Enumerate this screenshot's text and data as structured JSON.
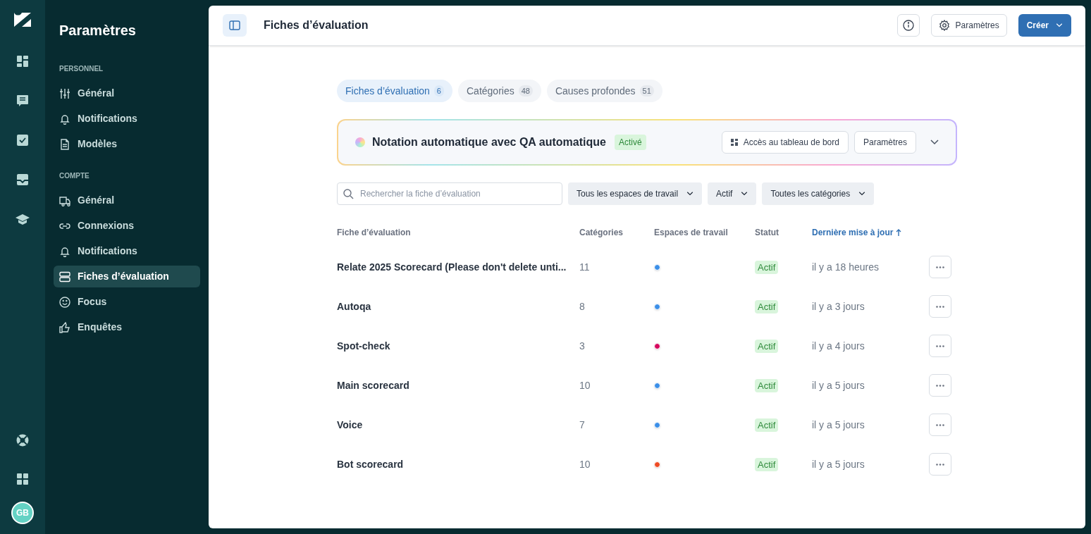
{
  "rail": {
    "avatar": "GB"
  },
  "nav": {
    "title": "Paramètres",
    "sections": [
      {
        "label": "PERSONNEL",
        "items": [
          {
            "label": "Général",
            "selected": false
          },
          {
            "label": "Notifications",
            "selected": false
          },
          {
            "label": "Modèles",
            "selected": false
          }
        ]
      },
      {
        "label": "COMPTE",
        "items": [
          {
            "label": "Général",
            "selected": false
          },
          {
            "label": "Connexions",
            "selected": false
          },
          {
            "label": "Notifications",
            "selected": false
          },
          {
            "label": "Fiches d’évaluation",
            "selected": true
          },
          {
            "label": "Focus",
            "selected": false
          },
          {
            "label": "Enquêtes",
            "selected": false
          }
        ]
      }
    ]
  },
  "header": {
    "title": "Fiches d’évaluation",
    "settings_button": "Paramètres",
    "create_button": "Créer"
  },
  "tabs": [
    {
      "label": "Fiches d’évaluation",
      "count": "6",
      "selected": true
    },
    {
      "label": "Catégories",
      "count": "48",
      "selected": false
    },
    {
      "label": "Causes profondes",
      "count": "51",
      "selected": false
    }
  ],
  "banner": {
    "title": "Notation automatique avec QA automatique",
    "badge": "Activé",
    "dashboard_button": "Accès au tableau de bord",
    "settings_button": "Paramètres"
  },
  "filters": {
    "search": {
      "placeholder": "Rechercher la fiche d’évaluation"
    },
    "dropdowns": [
      "Tous les espaces de travail",
      "Actif",
      "Toutes les catégories"
    ]
  },
  "table": {
    "columns": [
      {
        "label": "Fiche d’évaluation",
        "sorted": false
      },
      {
        "label": "Catégories",
        "sorted": false
      },
      {
        "label": "Espaces de travail",
        "sorted": false
      },
      {
        "label": "Statut",
        "sorted": false
      },
      {
        "label": "Dernière mise à jour",
        "sorted": true
      }
    ],
    "rows": [
      {
        "name": "Relate 2025 Scorecard (Please don't delete unti...",
        "categories": "11",
        "color": "#3b8fe8",
        "status": "Actif",
        "updated": "il y a 18 heures"
      },
      {
        "name": "Autoqa",
        "categories": "8",
        "color": "#3b8fe8",
        "status": "Actif",
        "updated": "il y a 3 jours"
      },
      {
        "name": "Spot-check",
        "categories": "3",
        "color": "#d6085e",
        "status": "Actif",
        "updated": "il y a 4 jours"
      },
      {
        "name": "Main scorecard",
        "categories": "10",
        "color": "#3b8fe8",
        "status": "Actif",
        "updated": "il y a 5 jours"
      },
      {
        "name": "Voice",
        "categories": "7",
        "color": "#3b8fe8",
        "status": "Actif",
        "updated": "il y a 5 jours"
      },
      {
        "name": "Bot scorecard",
        "categories": "10",
        "color": "#ee4a24",
        "status": "Actif",
        "updated": "il y a 5 jours"
      }
    ]
  }
}
